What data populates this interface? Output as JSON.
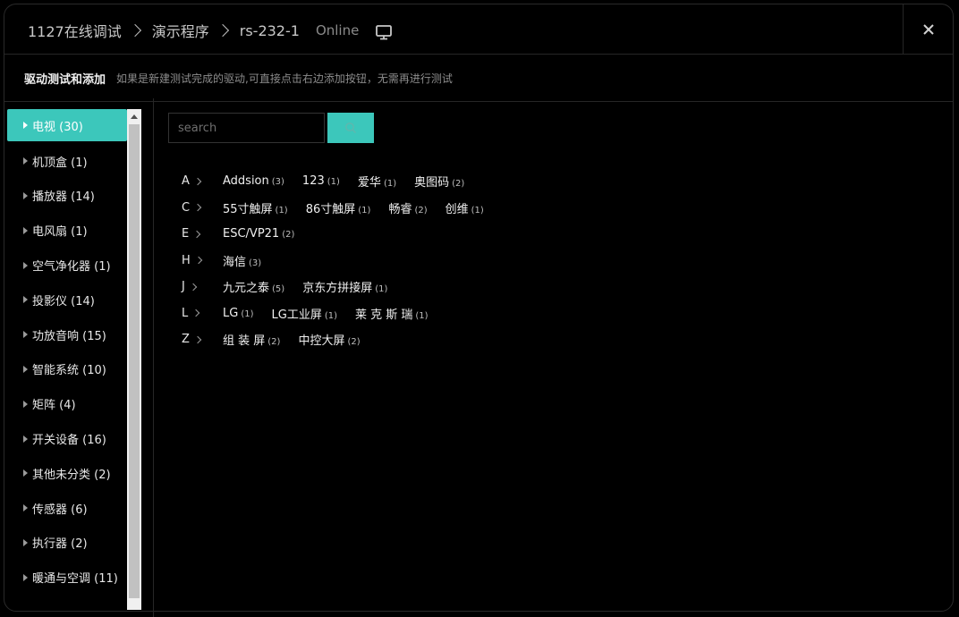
{
  "header": {
    "breadcrumbs": [
      "1127在线调试",
      "演示程序",
      "rs-232-1"
    ],
    "status": "Online"
  },
  "subheader": {
    "title": "驱动测试和添加",
    "description": "如果是新建测试完成的驱动,可直接点击右边添加按钮，无需再进行测试"
  },
  "sidebar": {
    "items": [
      {
        "label": "电视 (30)",
        "active": true
      },
      {
        "label": "机顶盒 (1)"
      },
      {
        "label": "播放器 (14)"
      },
      {
        "label": "电风扇 (1)"
      },
      {
        "label": "空气净化器 (1)"
      },
      {
        "label": "投影仪 (14)"
      },
      {
        "label": "功放音响 (15)"
      },
      {
        "label": "智能系统 (10)"
      },
      {
        "label": "矩阵 (4)"
      },
      {
        "label": "开关设备 (16)"
      },
      {
        "label": "其他未分类 (2)"
      },
      {
        "label": "传感器 (6)"
      },
      {
        "label": "执行器 (2)"
      },
      {
        "label": "暖通与空调 (11)"
      }
    ]
  },
  "search": {
    "placeholder": "search",
    "value": ""
  },
  "brands": [
    {
      "letter": "A",
      "items": [
        {
          "name": "Addsion",
          "count": "(3)"
        },
        {
          "name": "123",
          "count": "(1)"
        },
        {
          "name": "爱华",
          "count": "(1)"
        },
        {
          "name": "奥图码",
          "count": "(2)"
        }
      ]
    },
    {
      "letter": "C",
      "items": [
        {
          "name": "55寸触屏",
          "count": "(1)"
        },
        {
          "name": "86寸触屏",
          "count": "(1)"
        },
        {
          "name": "畅睿",
          "count": "(2)"
        },
        {
          "name": "创维",
          "count": "(1)"
        }
      ]
    },
    {
      "letter": "E",
      "items": [
        {
          "name": "ESC/VP21",
          "count": "(2)"
        }
      ]
    },
    {
      "letter": "H",
      "items": [
        {
          "name": "海信",
          "count": "(3)"
        }
      ]
    },
    {
      "letter": "J",
      "items": [
        {
          "name": "九元之泰",
          "count": "(5)"
        },
        {
          "name": "京东方拼接屏",
          "count": "(1)"
        }
      ]
    },
    {
      "letter": "L",
      "items": [
        {
          "name": "LG",
          "count": "(1)"
        },
        {
          "name": "LG工业屏",
          "count": "(1)"
        },
        {
          "name": "莱 克 斯 瑞",
          "count": "(1)"
        }
      ]
    },
    {
      "letter": "Z",
      "items": [
        {
          "name": "组 装 屏",
          "count": "(2)"
        },
        {
          "name": "中控大屏",
          "count": "(2)"
        }
      ]
    }
  ],
  "colors": {
    "accent": "#3cc7bb",
    "background": "#000000"
  },
  "icons": {
    "monitor": "monitor-icon",
    "close": "close-icon",
    "search": "search-icon"
  }
}
